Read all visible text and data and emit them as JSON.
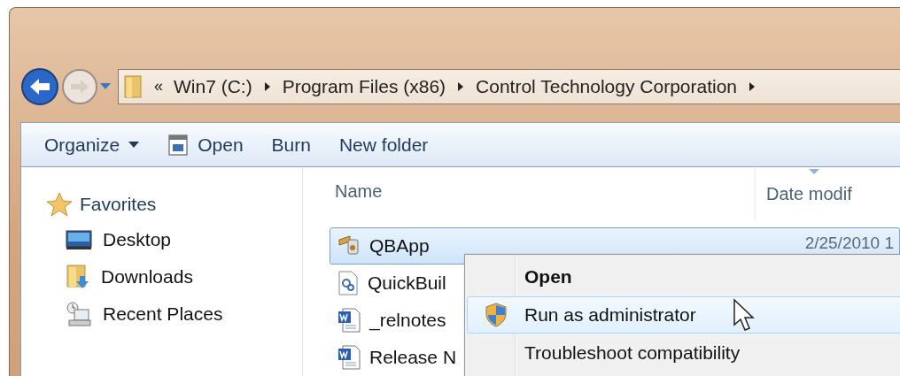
{
  "address_bar": {
    "overflow": "«",
    "breadcrumbs": [
      "Win7 (C:)",
      "Program Files (x86)",
      "Control Technology Corporation"
    ]
  },
  "toolbar": [
    {
      "label": "Organize",
      "kind": "menu"
    },
    {
      "label": "Open",
      "kind": "icon"
    },
    {
      "label": "Burn",
      "kind": "plain"
    },
    {
      "label": "New folder",
      "kind": "plain"
    }
  ],
  "sidebar": {
    "header": "Favorites",
    "items": [
      {
        "label": "Desktop",
        "kind": "desktop"
      },
      {
        "label": "Downloads",
        "kind": "downloads"
      },
      {
        "label": "Recent Places",
        "kind": "recent"
      }
    ]
  },
  "file_list": {
    "columns": [
      "Name",
      "Date modif"
    ],
    "rows": [
      {
        "name": "QBApp",
        "kind": "app",
        "date": "2/25/2010 1",
        "selected": true
      },
      {
        "name": "QuickBuil",
        "kind": "config",
        "selected": false
      },
      {
        "name": "_relnotes",
        "kind": "doc",
        "selected": false
      },
      {
        "name": "Release N",
        "kind": "doc",
        "selected": false
      }
    ]
  },
  "context_menu": {
    "items": [
      {
        "label": "Open",
        "kind": "default",
        "selected": false
      },
      {
        "label": "Run as administrator",
        "kind": "shield",
        "selected": true
      },
      {
        "label": "Troubleshoot compatibility",
        "kind": "plain",
        "selected": false
      }
    ]
  }
}
